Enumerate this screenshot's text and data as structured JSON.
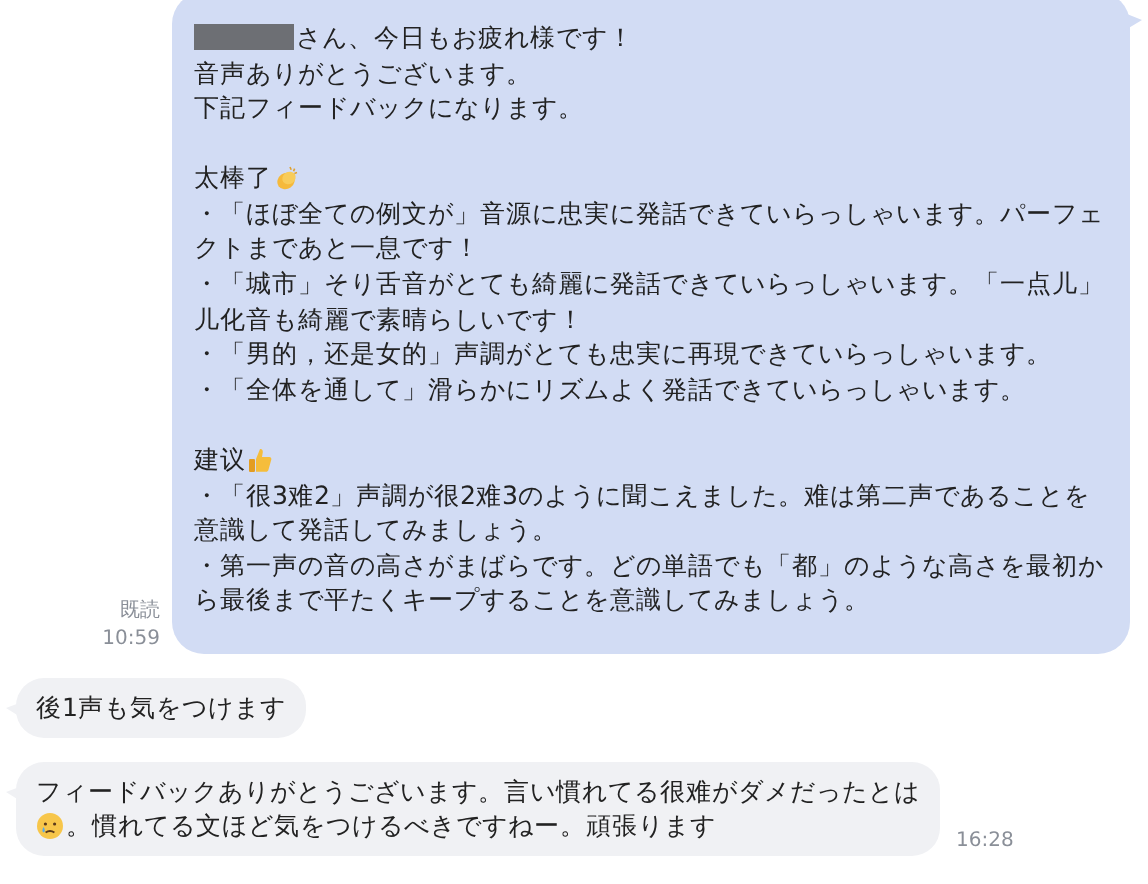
{
  "outgoing": {
    "read_label": "既読",
    "time": "10:59",
    "paragraphs": [
      [
        {
          "text": "さん、今日もお疲れ様です！",
          "redacted": true
        },
        {
          "text": "音声ありがとうございます。"
        },
        {
          "text": "下記フィードバックになります。"
        }
      ],
      [
        {
          "text": "太棒了",
          "kind": "clap"
        },
        {
          "text": "・「ほぼ全ての例文が」音源に忠実に発話できていらっしゃいます。パーフェ"
        },
        {
          "text": "クトまであと一息です！"
        },
        {
          "text": "・「城市」そり舌音がとても綺麗に発話できていらっしゃいます。「一点儿」"
        },
        {
          "text": "儿化音も綺麗で素晴らしいです！"
        },
        {
          "text": "・「男的，还是女的」声調がとても忠実に再現できていらっしゃいます。"
        },
        {
          "text": "・「全体を通して」滑らかにリズムよく発話できていらっしゃいます。"
        }
      ],
      [
        {
          "text": "建议",
          "kind": "thumbs"
        },
        {
          "text": "・「很3难2」声調が很2难3のように聞こえました。难は第二声であることを"
        },
        {
          "text": "意識して発話してみましょう。"
        },
        {
          "text": "・第一声の音の高さがまばらです。どの単語でも「都」のような高さを最初か"
        },
        {
          "text": "ら最後まで平たくキープすることを意識してみましょう。"
        }
      ]
    ]
  },
  "incoming": [
    {
      "lines": [
        {
          "text": "後1声も気をつけます"
        }
      ]
    },
    {
      "time": "16:28",
      "lines": [
        {
          "text": "フィードバックありがとうございます。言い慣れてる很难がダメだったとは"
        },
        {
          "text": "。慣れてる文ほど気をつけるべきですねー。頑張ります",
          "kind": "sad"
        }
      ]
    }
  ]
}
